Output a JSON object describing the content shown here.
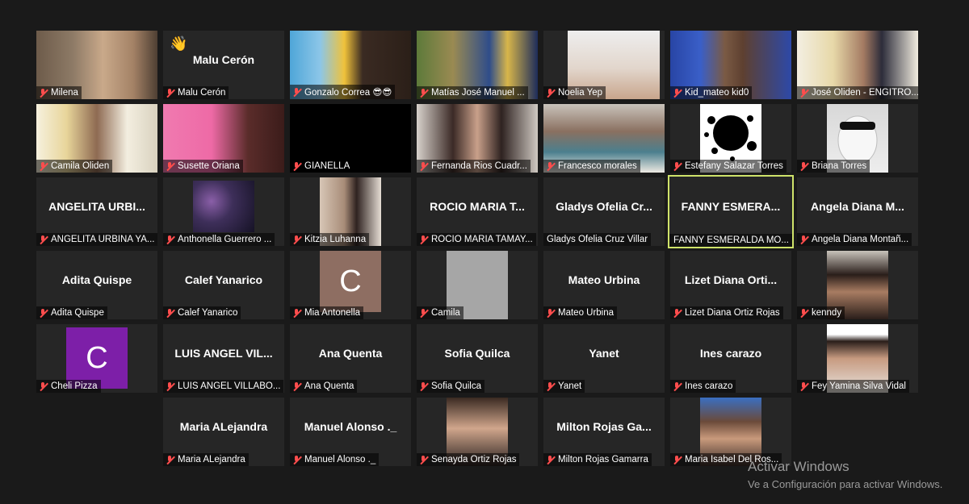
{
  "participants": [
    {
      "label": "Milena"
    },
    {
      "big_name": "Malu Cerón",
      "label": "Malu Cerón",
      "reaction": "👋"
    },
    {
      "label": "Gonzalo Correa 😎😎"
    },
    {
      "label": "Matías José Manuel ..."
    },
    {
      "label": "Noelia Yep"
    },
    {
      "label": "Kid_mateo kid0"
    },
    {
      "label": "José Oliden - ENGITRO..."
    },
    {
      "label": "Camila Oliden"
    },
    {
      "label": "Susette Oriana"
    },
    {
      "label": "GIANELLA"
    },
    {
      "label": "Fernanda Rios Cuadr..."
    },
    {
      "label": "Francesco morales"
    },
    {
      "label": "Estefany Salazar Torres"
    },
    {
      "label": "Briana Torres"
    },
    {
      "big_name": "ANGELITA URBI...",
      "label": "ANGELITA URBINA YA..."
    },
    {
      "label": "Anthonella Guerrero ..."
    },
    {
      "label": "Kitzia Luhanna"
    },
    {
      "big_name": "ROCIO MARIA T...",
      "label": "ROCIO MARIA TAMAY..."
    },
    {
      "big_name": "Gladys Ofelia Cr...",
      "label": "Gladys Ofelia Cruz Villar"
    },
    {
      "big_name": "FANNY ESMERA...",
      "label": "FANNY ESMERALDA MO..."
    },
    {
      "big_name": "Angela Diana M...",
      "label": "Angela Diana Montañ..."
    },
    {
      "big_name": "Adita Quispe",
      "label": "Adita Quispe"
    },
    {
      "big_name": "Calef Yanarico",
      "label": "Calef Yanarico"
    },
    {
      "label": "Mia Antonella",
      "initial": "C"
    },
    {
      "label": "Camila"
    },
    {
      "big_name": "Mateo Urbina",
      "label": "Mateo Urbina"
    },
    {
      "big_name": "Lizet Diana Orti...",
      "label": "Lizet Diana Ortiz Rojas"
    },
    {
      "label": "kenndy"
    },
    {
      "label": "Cheli Pizza",
      "initial": "C"
    },
    {
      "big_name": "LUIS ANGEL VIL...",
      "label": "LUIS ANGEL VILLABO..."
    },
    {
      "big_name": "Ana Quenta",
      "label": "Ana Quenta"
    },
    {
      "big_name": "Sofia Quilca",
      "label": "Sofia Quilca"
    },
    {
      "big_name": "Yanet",
      "label": "Yanet"
    },
    {
      "big_name": "Ines carazo",
      "label": "Ines carazo"
    },
    {
      "label": "Fey Yamina Silva Vidal"
    },
    {
      "big_name": "Maria ALejandra",
      "label": "Maria ALejandra"
    },
    {
      "big_name": "Manuel Alonso ._",
      "label": "Manuel Alonso ._"
    },
    {
      "label": "Senayda Ortiz Rojas"
    },
    {
      "big_name": "Milton Rojas Ga...",
      "label": "Milton Rojas Gamarra"
    },
    {
      "label": "Maria Isabel Del Ros..."
    }
  ],
  "watermark": {
    "line1": "Activar Windows",
    "line2": "Ve a Configuración para activar Windows."
  },
  "colors": {
    "active_speaker_border": "#cfe36a",
    "muted_mic": "#ff4d4d"
  }
}
